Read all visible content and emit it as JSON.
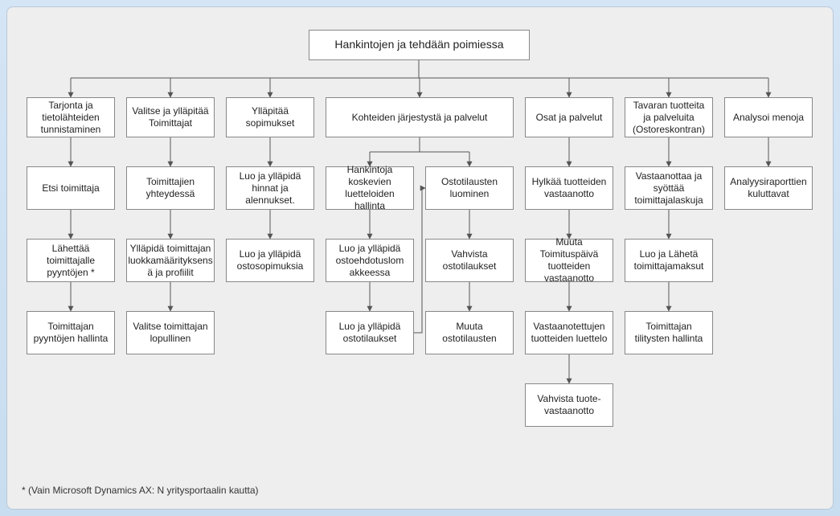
{
  "title": "Hankintojen ja tehdään poimiessa",
  "footnote": "* (Vain Microsoft Dynamics AX: N yritysportaalin kautta)",
  "col1": {
    "h": "Tarjonta ja tietolähteiden tunnistaminen",
    "r1": "Etsi toimittaja",
    "r2": "Lähettää toimittajalle pyyntöjen *",
    "r3": "Toimittajan pyyntöjen hallinta"
  },
  "col2": {
    "h": "Valitse ja ylläpitää Toimittajat",
    "r1": "Toimittajien yhteydessä",
    "r2": "Ylläpidä toimittajan luokkamäärityksens ä ja profiilit",
    "r3": "Valitse toimittajan lopullinen"
  },
  "col3": {
    "h": "Ylläpitää sopimukset",
    "r1": "Luo ja ylläpidä hinnat ja alennukset.",
    "r2": "Luo ja ylläpidä ostosopimuksia"
  },
  "col4": {
    "h": "Kohteiden järjestystä ja palvelut",
    "a1": "Hankintoja koskevien luetteloiden hallinta",
    "a2": "Luo ja ylläpidä ostoehdotuslom akkeessa",
    "a3": "Luo ja ylläpidä ostotilaukset",
    "b1": "Ostotilausten luominen",
    "b2": "Vahvista ostotilaukset",
    "b3": "Muuta ostotilausten"
  },
  "col5": {
    "h": "Osat ja palvelut",
    "r1": "Hylkää tuotteiden vastaanotto",
    "r2": "Muuta Toimituspäivä tuotteiden vastaanotto",
    "r3": "Vastaanotettujen tuotteiden luettelo",
    "r4": "Vahvista tuote-vastaanotto"
  },
  "col6": {
    "h": "Tavaran tuotteita ja palveluita (Ostoreskontran)",
    "r1": "Vastaanottaa ja syöttää toimittajalaskuja",
    "r2": "Luo ja Lähetä toimittajamaksut",
    "r3": "Toimittajan tilitysten hallinta"
  },
  "col7": {
    "h": "Analysoi menoja",
    "r1": "Analyysiraporttien kuluttavat"
  }
}
